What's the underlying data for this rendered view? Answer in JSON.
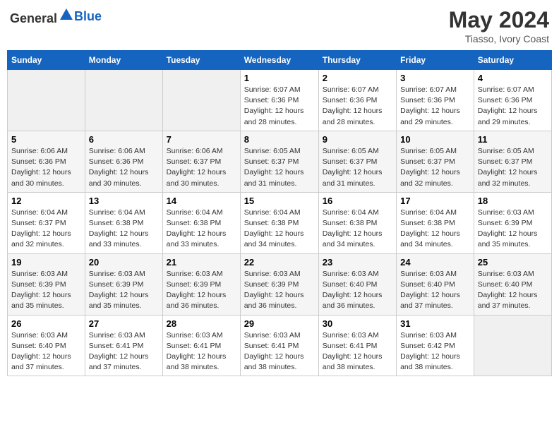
{
  "header": {
    "logo_general": "General",
    "logo_blue": "Blue",
    "month_year": "May 2024",
    "location": "Tiasso, Ivory Coast"
  },
  "weekdays": [
    "Sunday",
    "Monday",
    "Tuesday",
    "Wednesday",
    "Thursday",
    "Friday",
    "Saturday"
  ],
  "weeks": [
    [
      {
        "day": "",
        "info": ""
      },
      {
        "day": "",
        "info": ""
      },
      {
        "day": "",
        "info": ""
      },
      {
        "day": "1",
        "info": "Sunrise: 6:07 AM\nSunset: 6:36 PM\nDaylight: 12 hours\nand 28 minutes."
      },
      {
        "day": "2",
        "info": "Sunrise: 6:07 AM\nSunset: 6:36 PM\nDaylight: 12 hours\nand 28 minutes."
      },
      {
        "day": "3",
        "info": "Sunrise: 6:07 AM\nSunset: 6:36 PM\nDaylight: 12 hours\nand 29 minutes."
      },
      {
        "day": "4",
        "info": "Sunrise: 6:07 AM\nSunset: 6:36 PM\nDaylight: 12 hours\nand 29 minutes."
      }
    ],
    [
      {
        "day": "5",
        "info": "Sunrise: 6:06 AM\nSunset: 6:36 PM\nDaylight: 12 hours\nand 30 minutes."
      },
      {
        "day": "6",
        "info": "Sunrise: 6:06 AM\nSunset: 6:36 PM\nDaylight: 12 hours\nand 30 minutes."
      },
      {
        "day": "7",
        "info": "Sunrise: 6:06 AM\nSunset: 6:37 PM\nDaylight: 12 hours\nand 30 minutes."
      },
      {
        "day": "8",
        "info": "Sunrise: 6:05 AM\nSunset: 6:37 PM\nDaylight: 12 hours\nand 31 minutes."
      },
      {
        "day": "9",
        "info": "Sunrise: 6:05 AM\nSunset: 6:37 PM\nDaylight: 12 hours\nand 31 minutes."
      },
      {
        "day": "10",
        "info": "Sunrise: 6:05 AM\nSunset: 6:37 PM\nDaylight: 12 hours\nand 32 minutes."
      },
      {
        "day": "11",
        "info": "Sunrise: 6:05 AM\nSunset: 6:37 PM\nDaylight: 12 hours\nand 32 minutes."
      }
    ],
    [
      {
        "day": "12",
        "info": "Sunrise: 6:04 AM\nSunset: 6:37 PM\nDaylight: 12 hours\nand 32 minutes."
      },
      {
        "day": "13",
        "info": "Sunrise: 6:04 AM\nSunset: 6:38 PM\nDaylight: 12 hours\nand 33 minutes."
      },
      {
        "day": "14",
        "info": "Sunrise: 6:04 AM\nSunset: 6:38 PM\nDaylight: 12 hours\nand 33 minutes."
      },
      {
        "day": "15",
        "info": "Sunrise: 6:04 AM\nSunset: 6:38 PM\nDaylight: 12 hours\nand 34 minutes."
      },
      {
        "day": "16",
        "info": "Sunrise: 6:04 AM\nSunset: 6:38 PM\nDaylight: 12 hours\nand 34 minutes."
      },
      {
        "day": "17",
        "info": "Sunrise: 6:04 AM\nSunset: 6:38 PM\nDaylight: 12 hours\nand 34 minutes."
      },
      {
        "day": "18",
        "info": "Sunrise: 6:03 AM\nSunset: 6:39 PM\nDaylight: 12 hours\nand 35 minutes."
      }
    ],
    [
      {
        "day": "19",
        "info": "Sunrise: 6:03 AM\nSunset: 6:39 PM\nDaylight: 12 hours\nand 35 minutes."
      },
      {
        "day": "20",
        "info": "Sunrise: 6:03 AM\nSunset: 6:39 PM\nDaylight: 12 hours\nand 35 minutes."
      },
      {
        "day": "21",
        "info": "Sunrise: 6:03 AM\nSunset: 6:39 PM\nDaylight: 12 hours\nand 36 minutes."
      },
      {
        "day": "22",
        "info": "Sunrise: 6:03 AM\nSunset: 6:39 PM\nDaylight: 12 hours\nand 36 minutes."
      },
      {
        "day": "23",
        "info": "Sunrise: 6:03 AM\nSunset: 6:40 PM\nDaylight: 12 hours\nand 36 minutes."
      },
      {
        "day": "24",
        "info": "Sunrise: 6:03 AM\nSunset: 6:40 PM\nDaylight: 12 hours\nand 37 minutes."
      },
      {
        "day": "25",
        "info": "Sunrise: 6:03 AM\nSunset: 6:40 PM\nDaylight: 12 hours\nand 37 minutes."
      }
    ],
    [
      {
        "day": "26",
        "info": "Sunrise: 6:03 AM\nSunset: 6:40 PM\nDaylight: 12 hours\nand 37 minutes."
      },
      {
        "day": "27",
        "info": "Sunrise: 6:03 AM\nSunset: 6:41 PM\nDaylight: 12 hours\nand 37 minutes."
      },
      {
        "day": "28",
        "info": "Sunrise: 6:03 AM\nSunset: 6:41 PM\nDaylight: 12 hours\nand 38 minutes."
      },
      {
        "day": "29",
        "info": "Sunrise: 6:03 AM\nSunset: 6:41 PM\nDaylight: 12 hours\nand 38 minutes."
      },
      {
        "day": "30",
        "info": "Sunrise: 6:03 AM\nSunset: 6:41 PM\nDaylight: 12 hours\nand 38 minutes."
      },
      {
        "day": "31",
        "info": "Sunrise: 6:03 AM\nSunset: 6:42 PM\nDaylight: 12 hours\nand 38 minutes."
      },
      {
        "day": "",
        "info": ""
      }
    ]
  ]
}
